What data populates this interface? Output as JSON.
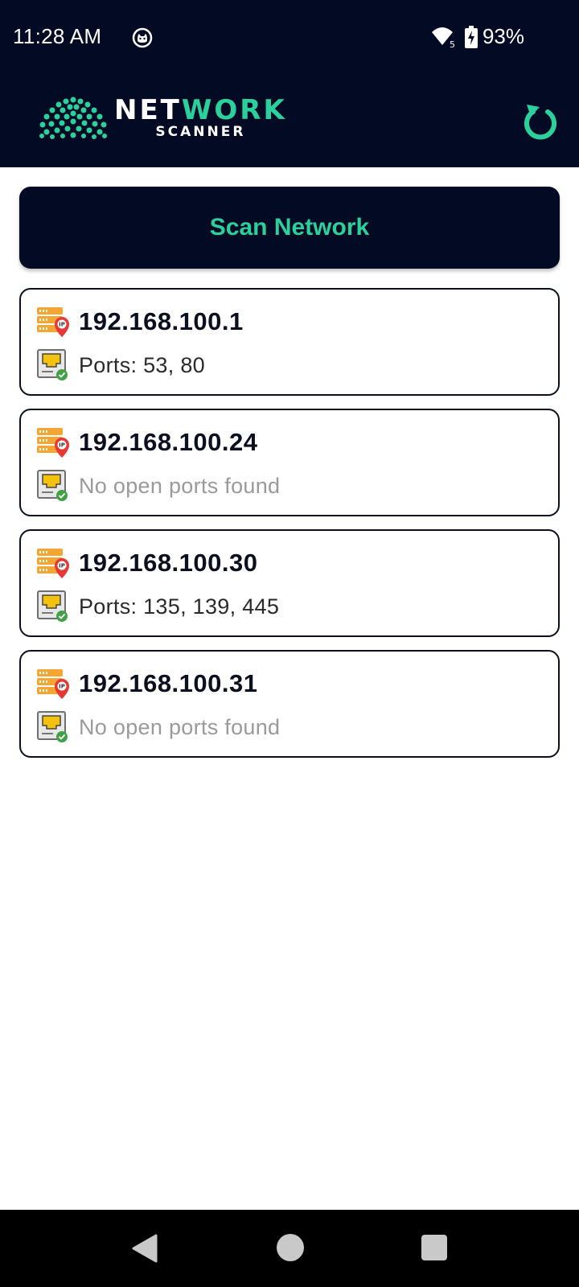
{
  "status_bar": {
    "time": "11:28 AM",
    "notification_icon": "cat-face-icon",
    "wifi_icon": "wifi-icon",
    "wifi_badge": "5",
    "battery_icon": "battery-charging-icon",
    "battery": "93%"
  },
  "header": {
    "logo_word_1": "NET",
    "logo_word_2": "WORK",
    "logo_subtitle": "SCANNER",
    "refresh_icon": "refresh-icon",
    "accent_color": "#2bd19d",
    "background_color": "#030a23"
  },
  "scan_button": {
    "label": "Scan Network"
  },
  "devices": [
    {
      "ip": "192.168.100.1",
      "ports": "Ports: 53, 80",
      "has_open_ports": true
    },
    {
      "ip": "192.168.100.24",
      "ports": "No open ports found",
      "has_open_ports": false
    },
    {
      "ip": "192.168.100.30",
      "ports": "Ports: 135, 139, 445",
      "has_open_ports": true
    },
    {
      "ip": "192.168.100.31",
      "ports": "No open ports found",
      "has_open_ports": false
    }
  ],
  "nav_bar": {
    "back_icon": "back-triangle-icon",
    "home_icon": "home-circle-icon",
    "recents_icon": "recents-square-icon"
  }
}
